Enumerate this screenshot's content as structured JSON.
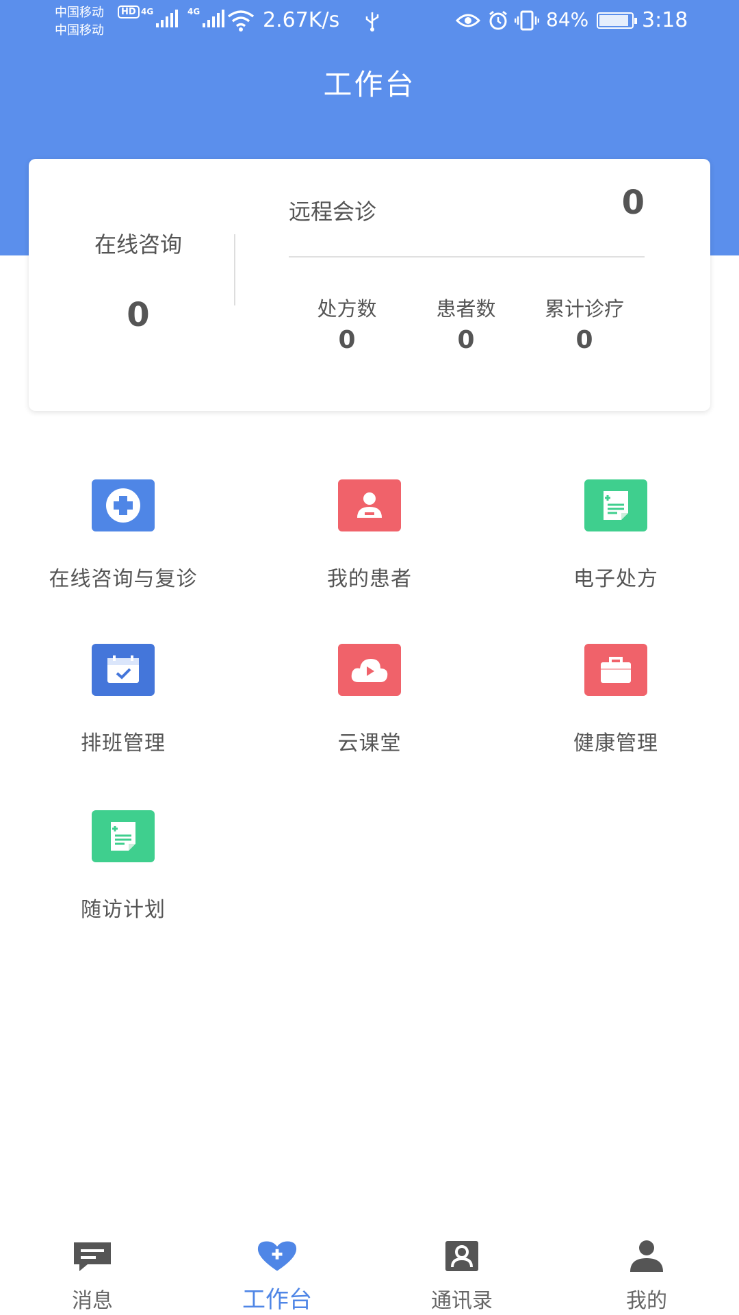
{
  "status_bar": {
    "carrier_1": "中国移动",
    "carrier_2": "中国移动",
    "hd_badge": "HD",
    "network_1": "4G",
    "network_2": "4G",
    "speed": "2.67K/s",
    "battery": "84%",
    "time": "3:18"
  },
  "header": {
    "title": "工作台"
  },
  "stats": {
    "online_consult_label": "在线咨询",
    "online_consult_value": "0",
    "remote_consult_label": "远程会诊",
    "remote_consult_value": "0",
    "prescriptions_label": "处方数",
    "prescriptions_value": "0",
    "patients_label": "患者数",
    "patients_value": "0",
    "total_treatments_label": "累计诊疗",
    "total_treatments_value": "0"
  },
  "menu": {
    "items": [
      {
        "label": "在线咨询与复诊",
        "icon": "medical-cross-icon",
        "color": "#4f86e6"
      },
      {
        "label": "我的患者",
        "icon": "patient-icon",
        "color": "#f0626a"
      },
      {
        "label": "电子处方",
        "icon": "prescription-icon",
        "color": "#3fcf8e"
      },
      {
        "label": "排班管理",
        "icon": "calendar-icon",
        "color": "#4476da"
      },
      {
        "label": "云课堂",
        "icon": "cloud-play-icon",
        "color": "#f0626a"
      },
      {
        "label": "健康管理",
        "icon": "briefcase-icon",
        "color": "#f0626a"
      },
      {
        "label": "随访计划",
        "icon": "followup-plan-icon",
        "color": "#3fcf8e"
      }
    ]
  },
  "bottom_nav": {
    "messages": "消息",
    "workbench": "工作台",
    "contacts": "通讯录",
    "mine": "我的"
  },
  "colors": {
    "primary": "#5b8fec",
    "active_tab": "#4f86e6",
    "nav_icon": "#555555"
  }
}
